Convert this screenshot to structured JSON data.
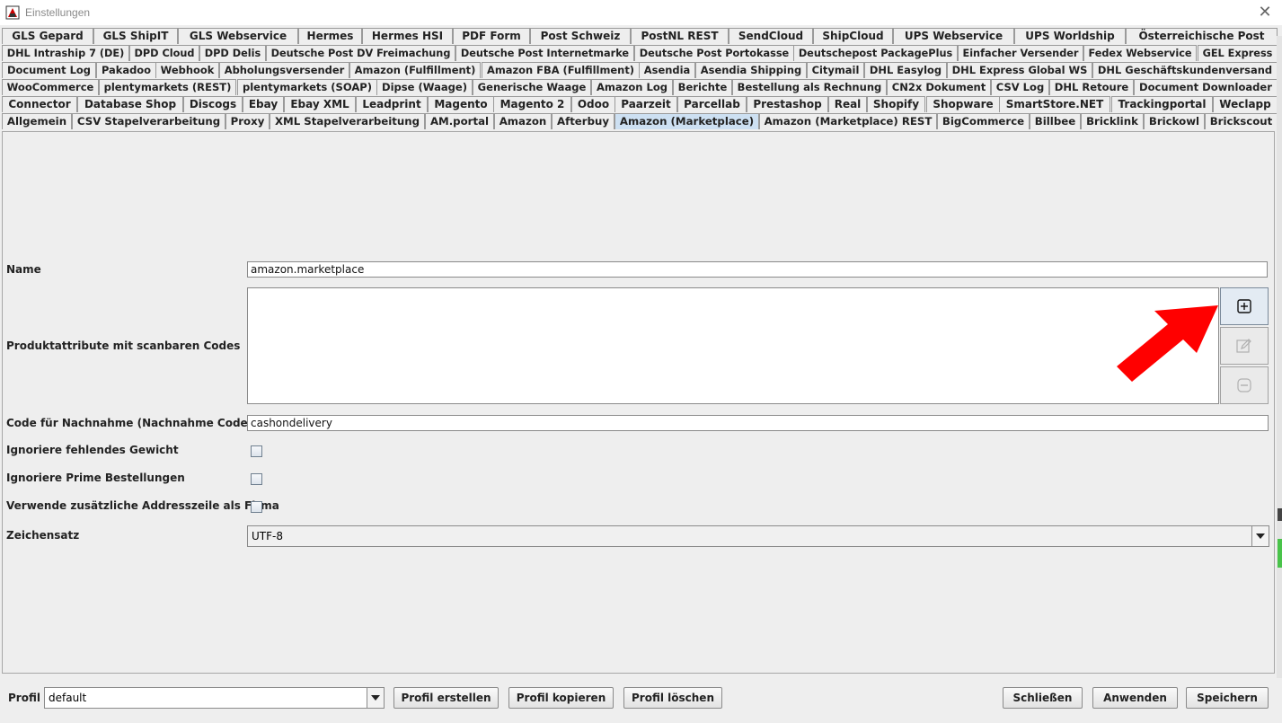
{
  "window": {
    "title": "Einstellungen",
    "close_glyph": "✕"
  },
  "tab_rows": [
    [
      "GLS Gepard",
      "GLS ShipIT",
      "GLS Webservice",
      "Hermes",
      "Hermes HSI",
      "PDF Form",
      "Post Schweiz",
      "PostNL REST",
      "SendCloud",
      "ShipCloud",
      "UPS Webservice",
      "UPS Worldship",
      "Österreichische Post"
    ],
    [
      "DHL Intraship 7 (DE)",
      "DPD Cloud",
      "DPD Delis",
      "Deutsche Post DV Freimachung",
      "Deutsche Post Internetmarke",
      "Deutsche Post Portokasse",
      "Deutschepost PackagePlus",
      "Einfacher Versender",
      "Fedex Webservice",
      "GEL Express"
    ],
    [
      "Document Log",
      "Pakadoo",
      "Webhook",
      "Abholungsversender",
      "Amazon (Fulfillment)",
      "Amazon FBA (Fulfillment)",
      "Asendia",
      "Asendia Shipping",
      "Citymail",
      "DHL Easylog",
      "DHL Express Global WS",
      "DHL Geschäftskundenversand"
    ],
    [
      "WooCommerce",
      "plentymarkets (REST)",
      "plentymarkets (SOAP)",
      "Dipse (Waage)",
      "Generische Waage",
      "Amazon Log",
      "Berichte",
      "Bestellung als Rechnung",
      "CN2x Dokument",
      "CSV Log",
      "DHL Retoure",
      "Document Downloader"
    ],
    [
      "Connector",
      "Database Shop",
      "Discogs",
      "Ebay",
      "Ebay XML",
      "Leadprint",
      "Magento",
      "Magento 2",
      "Odoo",
      "Paarzeit",
      "Parcellab",
      "Prestashop",
      "Real",
      "Shopify",
      "Shopware",
      "SmartStore.NET",
      "Trackingportal",
      "Weclapp"
    ],
    [
      "Allgemein",
      "CSV Stapelverarbeitung",
      "Proxy",
      "XML Stapelverarbeitung",
      "AM.portal",
      "Amazon",
      "Afterbuy",
      "Amazon (Marketplace)",
      "Amazon (Marketplace) REST",
      "BigCommerce",
      "Billbee",
      "Bricklink",
      "Brickowl",
      "Brickscout"
    ]
  ],
  "active_tab": "Amazon (Marketplace)",
  "form": {
    "name_label": "Name",
    "name_value": "amazon.marketplace",
    "attributes_label": "Produktattribute mit scanbaren Codes",
    "cod_label": "Code für Nachnahme (Nachnahme Code)",
    "cod_value": "cashondelivery",
    "ignore_weight_label": "Ignoriere fehlendes Gewicht",
    "ignore_prime_label": "Ignoriere Prime Bestellungen",
    "extra_address_label": "Verwende zusätzliche Addresszeile als Firma",
    "charset_label": "Zeichensatz",
    "charset_value": "UTF-8",
    "checkboxes": {
      "ignore_weight": false,
      "ignore_prime": false,
      "extra_address": false
    }
  },
  "icons": {
    "add": "plus-square-icon",
    "edit": "pencil-icon",
    "remove": "minus-circle-icon",
    "annotation": "red-arrow"
  },
  "bottom": {
    "profile_label": "Profil",
    "profile_value": "default",
    "create_label": "Profil erstellen",
    "copy_label": "Profil kopieren",
    "delete_label": "Profil löschen",
    "close_label": "Schließen",
    "apply_label": "Anwenden",
    "save_label": "Speichern"
  },
  "colors": {
    "active_tab": "#cde0f2",
    "annotation_arrow": "#ff0000",
    "panel_bg": "#eeeeee"
  }
}
